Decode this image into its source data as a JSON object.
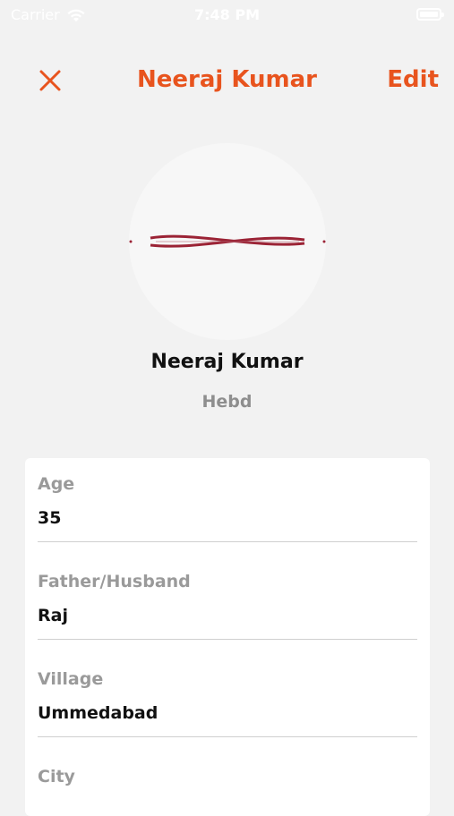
{
  "status_bar": {
    "carrier": "Carrier",
    "time": "7:48 PM"
  },
  "nav": {
    "title": "Neeraj Kumar",
    "edit_label": "Edit",
    "close_icon": "close-icon"
  },
  "profile": {
    "name": "Neeraj Kumar",
    "subtitle": "Hebd"
  },
  "fields": [
    {
      "label": "Age",
      "value": "35"
    },
    {
      "label": "Father/Husband",
      "value": "Raj"
    },
    {
      "label": "Village",
      "value": "Ummedabad"
    },
    {
      "label": "City",
      "value": ""
    }
  ],
  "colors": {
    "accent": "#e8541e",
    "background": "#f2f2f2",
    "card": "#ffffff"
  }
}
